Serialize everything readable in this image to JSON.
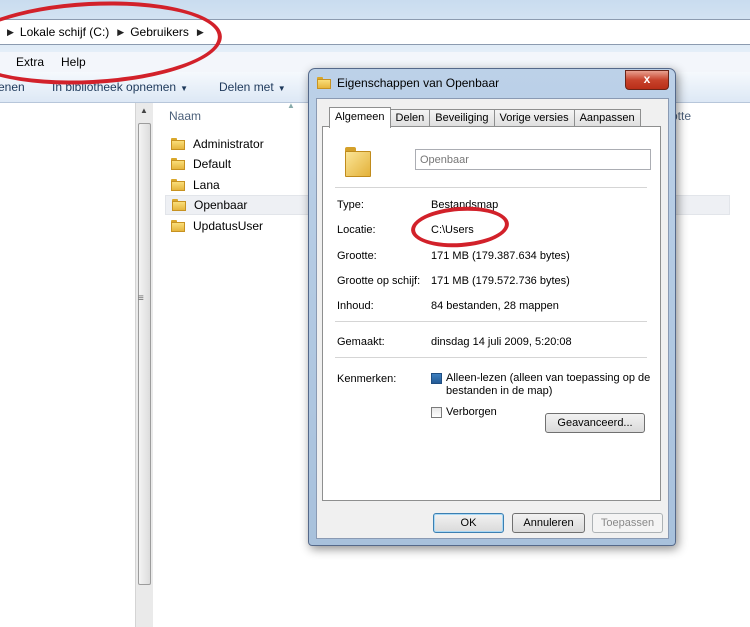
{
  "explorer": {
    "breadcrumb": [
      "Lokale schijf (C:)",
      "Gebruikers"
    ],
    "menu": [
      "Extra",
      "Help"
    ],
    "toolbar": {
      "left_partial": "enen",
      "middle_partial": "In bibliotheek opnemen",
      "share": "Delen met"
    },
    "columns": {
      "name": "Naam",
      "size_partial": "otte"
    },
    "files": [
      "Administrator",
      "Default",
      "Lana",
      "Openbaar",
      "UpdatusUser"
    ],
    "selected_file": "Openbaar"
  },
  "dialog": {
    "title": "Eigenschappen van Openbaar",
    "close": "x",
    "tabs": [
      "Algemeen",
      "Delen",
      "Beveiliging",
      "Vorige versies",
      "Aanpassen"
    ],
    "active_tab": "Algemeen",
    "name_value": "Openbaar",
    "properties": {
      "type_label": "Type:",
      "type_value": "Bestandsmap",
      "location_label": "Locatie:",
      "location_value": "C:\\Users",
      "size_label": "Grootte:",
      "size_value": "171 MB (179.387.634 bytes)",
      "disk_label": "Grootte op schijf:",
      "disk_value": "171 MB (179.572.736 bytes)",
      "contents_label": "Inhoud:",
      "contents_value": "84 bestanden, 28 mappen",
      "created_label": "Gemaakt:",
      "created_value": "dinsdag 14 juli 2009, 5:20:08",
      "attributes_label": "Kenmerken:"
    },
    "readonly_label": "Alleen-lezen (alleen van toepassing op de bestanden in de map)",
    "readonly_state": "indeterminate",
    "hidden_label": "Verborgen",
    "hidden_checked": false,
    "advanced_button": "Geavanceerd...",
    "ok_button": "OK",
    "cancel_button": "Annuleren",
    "apply_button": "Toepassen"
  },
  "annotation_color": "#d2212a"
}
